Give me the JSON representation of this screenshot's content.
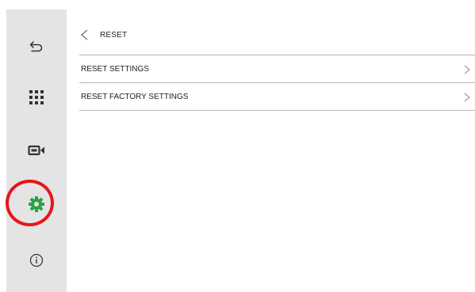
{
  "sidebar": {
    "items": [
      {
        "name": "back",
        "icon": "return-arrow-icon"
      },
      {
        "name": "apps",
        "icon": "grid-icon"
      },
      {
        "name": "camera",
        "icon": "video-camera-icon"
      },
      {
        "name": "settings",
        "icon": "gear-icon",
        "active": true
      },
      {
        "name": "info",
        "icon": "info-icon"
      }
    ],
    "active_color": "#2ea043",
    "icon_color": "#333333",
    "highlight_color": "#e8141b"
  },
  "header": {
    "title": "RESET",
    "back_icon": "chevron-left-icon"
  },
  "menu": {
    "items": [
      {
        "label": "RESET SETTINGS",
        "icon": "chevron-right-icon"
      },
      {
        "label": "RESET FACTORY SETTINGS",
        "icon": "chevron-right-icon"
      }
    ]
  }
}
